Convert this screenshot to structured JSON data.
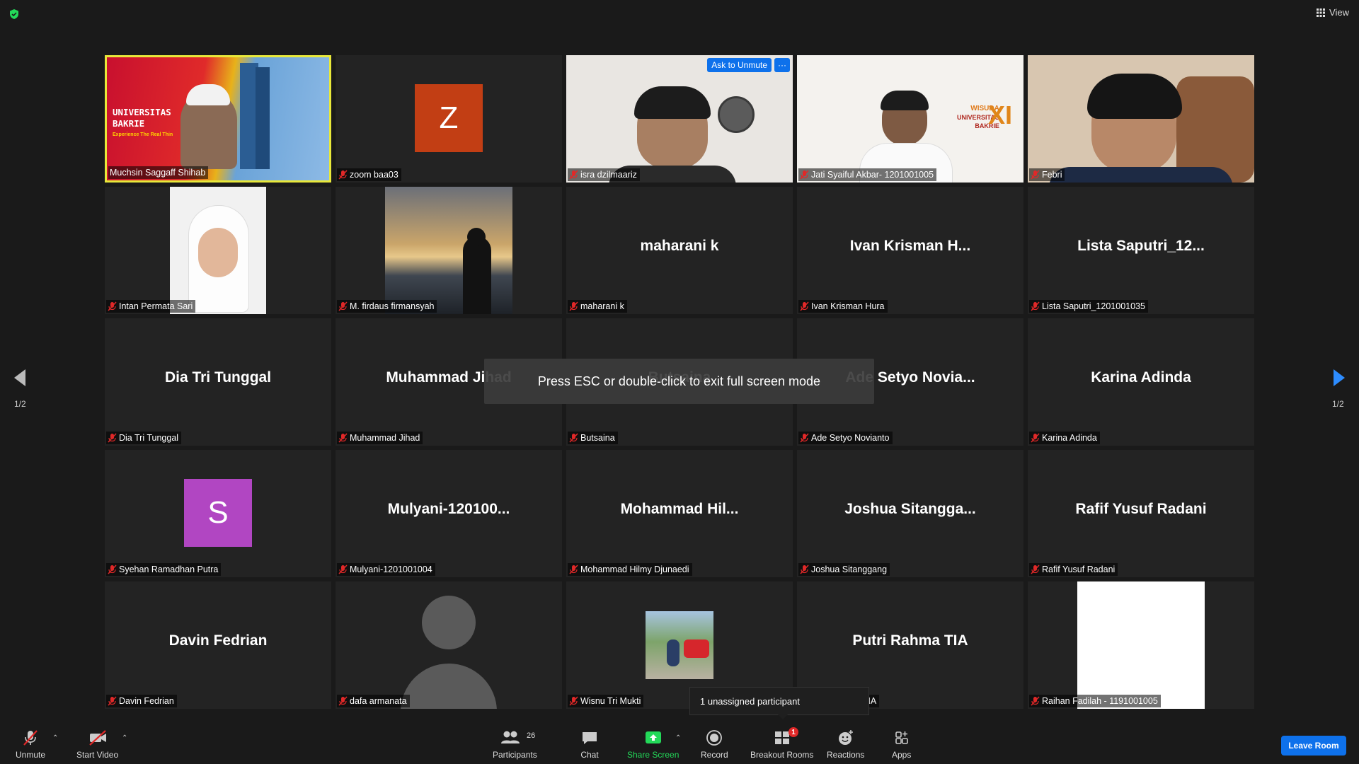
{
  "top": {
    "view_label": "View"
  },
  "participants": [
    {
      "label": "Muchsin Saggaff Shihab",
      "big": "",
      "avatar": "",
      "kind": "uni"
    },
    {
      "label": "zoom baa03",
      "big": "",
      "avatar": "Z",
      "kind": "letter",
      "color": "#c23e14"
    },
    {
      "label": "isra dzilmaariz",
      "big": "",
      "avatar": "",
      "kind": "cam1"
    },
    {
      "label": "Jati Syaiful Akbar- 1201001005",
      "big": "",
      "avatar": "",
      "kind": "cam2"
    },
    {
      "label": "Febri",
      "big": "",
      "avatar": "",
      "kind": "cam3"
    },
    {
      "label": "Intan Permata Sari",
      "big": "",
      "avatar": "",
      "kind": "cam4"
    },
    {
      "label": "M. firdaus firmansyah",
      "big": "",
      "avatar": "",
      "kind": "cam5"
    },
    {
      "label": "maharani k",
      "big": "maharani k",
      "avatar": "",
      "kind": "name"
    },
    {
      "label": "Ivan Krisman  Hura",
      "big": "Ivan Krisman  H...",
      "avatar": "",
      "kind": "name"
    },
    {
      "label": "Lista Saputri_1201001035",
      "big": "Lista  Saputri_12...",
      "avatar": "",
      "kind": "name"
    },
    {
      "label": "Dia Tri Tunggal",
      "big": "Dia Tri Tunggal",
      "avatar": "",
      "kind": "name"
    },
    {
      "label": "Muhammad Jihad",
      "big": "Muhammad Jihad",
      "avatar": "",
      "kind": "name"
    },
    {
      "label": "Butsaina",
      "big": "Butsaina",
      "avatar": "",
      "kind": "name"
    },
    {
      "label": "Ade Setyo Novianto",
      "big": "Ade  Setyo  Novia...",
      "avatar": "",
      "kind": "name"
    },
    {
      "label": "Karina Adinda",
      "big": "Karina Adinda",
      "avatar": "",
      "kind": "name"
    },
    {
      "label": "Syehan Ramadhan Putra",
      "big": "",
      "avatar": "S",
      "kind": "letter",
      "color": "#b146c2"
    },
    {
      "label": "Mulyani-1201001004",
      "big": "Mulyani-120100...",
      "avatar": "",
      "kind": "name"
    },
    {
      "label": "Mohammad Hilmy Djunaedi",
      "big": "Mohammad  Hil...",
      "avatar": "",
      "kind": "name"
    },
    {
      "label": "Joshua Sitanggang",
      "big": "Joshua  Sitangga...",
      "avatar": "",
      "kind": "name"
    },
    {
      "label": "Rafif Yusuf Radani",
      "big": "Rafif Yusuf Radani",
      "avatar": "",
      "kind": "name"
    },
    {
      "label": "Davin Fedrian",
      "big": "Davin Fedrian",
      "avatar": "",
      "kind": "name"
    },
    {
      "label": "dafa armanata",
      "big": "",
      "avatar": "",
      "kind": "person"
    },
    {
      "label": "Wisnu Tri Mukti",
      "big": "",
      "avatar": "",
      "kind": "cam6"
    },
    {
      "label": "Putri Rahma TIA",
      "big": "Putri Rahma TIA",
      "avatar": "",
      "kind": "name"
    },
    {
      "label": "Raihan Fadilah - 1191001005",
      "big": "",
      "avatar": "",
      "kind": "white"
    }
  ],
  "uni_slide": {
    "line1": "UNIVERSITAS",
    "line2": "BAKRIE",
    "tagline": "Experience The Real Thin"
  },
  "wisuda": {
    "word": "WISUDA",
    "line1": "UNIVERSITAS",
    "line2": "BAKRIE",
    "numeral": "XI"
  },
  "ask_unmute_label": "Ask to Unmute",
  "more_label": "···",
  "esc_message": "Press ESC or double-click to exit full screen mode",
  "page_left": "1/2",
  "page_right": "1/2",
  "tooltip": "1 unassigned participant",
  "toolbar": {
    "unmute": "Unmute",
    "start_video": "Start Video",
    "participants": "Participants",
    "participants_count": "26",
    "chat": "Chat",
    "share": "Share Screen",
    "record": "Record",
    "breakout": "Breakout Rooms",
    "breakout_badge": "1",
    "reactions": "Reactions",
    "apps": "Apps",
    "leave": "Leave Room"
  },
  "colors": {
    "active_border": "#e8e83a",
    "share_green": "#23d959",
    "leave_blue": "#0e71eb",
    "muted_red": "#e02828"
  }
}
